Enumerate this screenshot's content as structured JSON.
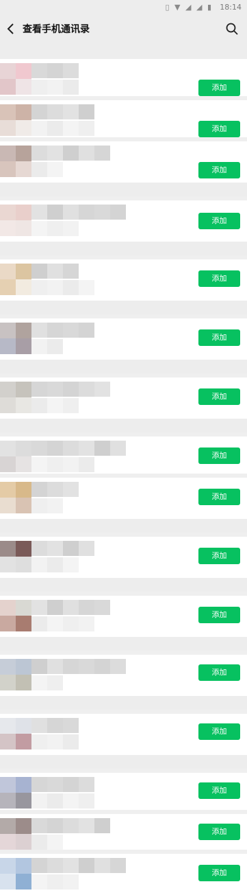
{
  "status_bar": {
    "time": "18:14",
    "icons": [
      "vibrate-icon",
      "wifi-icon",
      "signal-icon",
      "signal-icon",
      "battery-icon"
    ]
  },
  "header": {
    "title": "查看手机通讯录"
  },
  "contacts": [
    {
      "add_label": "添加"
    },
    {
      "add_label": "添加"
    },
    {
      "add_label": "添加"
    },
    {
      "add_label": "添加"
    },
    {
      "add_label": "添加"
    },
    {
      "add_label": "添加"
    },
    {
      "add_label": "添加"
    },
    {
      "add_label": "添加"
    },
    {
      "add_label": "添加"
    },
    {
      "add_label": "添加"
    },
    {
      "add_label": "添加"
    },
    {
      "add_label": "添加"
    },
    {
      "add_label": "添加"
    },
    {
      "add_label": "添加"
    },
    {
      "add_label": "添加"
    },
    {
      "add_label": "添加"
    }
  ],
  "colors": {
    "accent": "#07c160",
    "background": "#ededed",
    "row": "#ffffff"
  }
}
